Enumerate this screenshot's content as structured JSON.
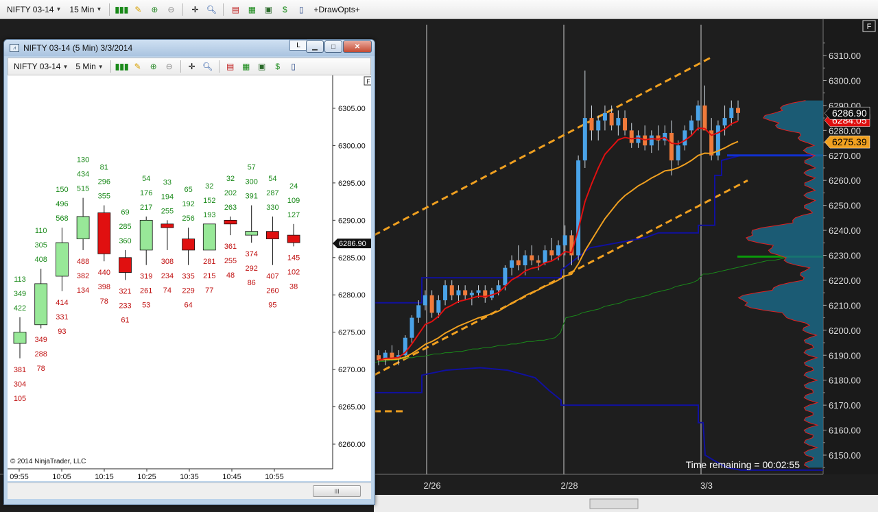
{
  "main_toolbar": {
    "instrument": "NIFTY 03-14",
    "interval": "15 Min",
    "draw_opts": "+DrawOpts+"
  },
  "float_window": {
    "title": "NIFTY 03-14 (5 Min)  3/3/2014",
    "l_button": "L",
    "instrument": "NIFTY 03-14",
    "interval": "5 Min",
    "scroll_thumb": "III"
  },
  "colors": {
    "bg_main": "#1e1e1e",
    "bull_candle": "#4aa3e8",
    "bear_candle": "#f07a3a",
    "ema_fast": "#e01010",
    "ema_slow": "#f0a020",
    "channel": "#f0a020",
    "vwap_band": "#1010a0",
    "green_line": "#1a8a1a",
    "profile_fill": "#1a6a8a",
    "profile_edge": "#e02020",
    "mini_bull": "#98e898",
    "mini_bear": "#e01010"
  },
  "chart_data": [
    {
      "type": "candlestick",
      "name": "main",
      "x_tick_labels": [
        "2/26",
        "2/28",
        "3/3"
      ],
      "y_tick_labels": [
        "6310.00",
        "6300.00",
        "6290.00",
        "6280.00",
        "6270.00",
        "6260.00",
        "6250.00",
        "6240.00",
        "6230.00",
        "6220.00",
        "6210.00",
        "6200.00",
        "6190.00",
        "6180.00",
        "6170.00",
        "6160.00",
        "6150.00"
      ],
      "ylim": [
        6142,
        6322
      ],
      "last_price_label": "6286.90",
      "hidden_price_label": "6284.05",
      "ema_price_label": "6275.39",
      "f_label": "F",
      "status_text": "Time remaining = 00:02:55",
      "ohlc": [
        [
          6190,
          6192,
          6186,
          6188
        ],
        [
          6188,
          6192,
          6186,
          6191
        ],
        [
          6191,
          6194,
          6188,
          6189
        ],
        [
          6189,
          6192,
          6186,
          6190
        ],
        [
          6190,
          6198,
          6189,
          6197
        ],
        [
          6197,
          6206,
          6195,
          6205
        ],
        [
          6205,
          6212,
          6203,
          6210
        ],
        [
          6210,
          6216,
          6208,
          6214
        ],
        [
          6214,
          6216,
          6205,
          6207
        ],
        [
          6207,
          6214,
          6205,
          6212
        ],
        [
          6212,
          6220,
          6210,
          6218
        ],
        [
          6218,
          6220,
          6212,
          6214
        ],
        [
          6214,
          6218,
          6211,
          6216
        ],
        [
          6216,
          6218,
          6212,
          6214
        ],
        [
          6214,
          6216,
          6210,
          6215
        ],
        [
          6215,
          6218,
          6213,
          6216
        ],
        [
          6216,
          6218,
          6211,
          6213
        ],
        [
          6213,
          6217,
          6212,
          6216
        ],
        [
          6216,
          6220,
          6214,
          6218
        ],
        [
          6218,
          6226,
          6216,
          6225
        ],
        [
          6225,
          6230,
          6222,
          6228
        ],
        [
          6228,
          6234,
          6224,
          6226
        ],
        [
          6226,
          6232,
          6222,
          6230
        ],
        [
          6230,
          6234,
          6226,
          6228
        ],
        [
          6228,
          6230,
          6224,
          6227
        ],
        [
          6227,
          6234,
          6226,
          6232
        ],
        [
          6232,
          6237,
          6228,
          6230
        ],
        [
          6230,
          6236,
          6228,
          6234
        ],
        [
          6234,
          6242,
          6230,
          6238
        ],
        [
          6238,
          6240,
          6226,
          6230
        ],
        [
          6230,
          6270,
          6228,
          6268
        ],
        [
          6268,
          6304,
          6265,
          6285
        ],
        [
          6285,
          6290,
          6276,
          6280
        ],
        [
          6280,
          6286,
          6276,
          6284
        ],
        [
          6284,
          6290,
          6280,
          6287
        ],
        [
          6287,
          6290,
          6280,
          6282
        ],
        [
          6282,
          6288,
          6278,
          6285
        ],
        [
          6285,
          6288,
          6278,
          6280
        ],
        [
          6280,
          6283,
          6273,
          6275
        ],
        [
          6275,
          6280,
          6273,
          6278
        ],
        [
          6278,
          6282,
          6272,
          6274
        ],
        [
          6274,
          6280,
          6271,
          6278
        ],
        [
          6278,
          6282,
          6272,
          6276
        ],
        [
          6276,
          6282,
          6274,
          6279
        ],
        [
          6279,
          6284,
          6262,
          6268
        ],
        [
          6268,
          6276,
          6266,
          6274
        ],
        [
          6274,
          6282,
          6272,
          6280
        ],
        [
          6280,
          6286,
          6278,
          6284
        ],
        [
          6284,
          6292,
          6280,
          6290
        ],
        [
          6290,
          6298,
          6286,
          6280
        ],
        [
          6280,
          6285,
          6268,
          6270
        ],
        [
          6270,
          6284,
          6268,
          6282
        ],
        [
          6282,
          6290,
          6278,
          6285
        ],
        [
          6285,
          6292,
          6282,
          6289
        ],
        [
          6289,
          6292,
          6284,
          6287
        ]
      ]
    },
    {
      "type": "candlestick",
      "name": "mini",
      "x_tick_labels": [
        "09:55",
        "10:05",
        "10:15",
        "10:25",
        "10:35",
        "10:45",
        "10:55"
      ],
      "y_tick_labels": [
        "6305.00",
        "6300.00",
        "6295.00",
        "6290.00",
        "6285.00",
        "6280.00",
        "6275.00",
        "6270.00",
        "6265.00",
        "6260.00"
      ],
      "ylim": [
        6257.5,
        6308.3
      ],
      "last_price_label": "6286.90",
      "f_label": "F",
      "copyright": "© 2014 NinjaTrader, LLC",
      "candles": [
        {
          "o": 6273.5,
          "h": 6277,
          "l": 6271.5,
          "c": 6275,
          "above": [
            "113",
            "349",
            "422"
          ],
          "below": [
            "381",
            "304",
            "105"
          ]
        },
        {
          "o": 6276,
          "h": 6283.5,
          "l": 6275.5,
          "c": 6281.5,
          "above": [
            "110",
            "305",
            "408"
          ],
          "below": [
            "349",
            "288",
            "78"
          ]
        },
        {
          "o": 6282.5,
          "h": 6289,
          "l": 6280.5,
          "c": 6287,
          "above": [
            "150",
            "496",
            "568"
          ],
          "below": [
            "414",
            "331",
            "93"
          ]
        },
        {
          "o": 6287.5,
          "h": 6293,
          "l": 6286,
          "c": 6290.5,
          "above": [
            "130",
            "434",
            "515"
          ],
          "below": [
            "488",
            "382",
            "134"
          ]
        },
        {
          "o": 6291,
          "h": 6292,
          "l": 6284.5,
          "c": 6285.5,
          "above": [
            "81",
            "296",
            "355"
          ],
          "below": [
            "440",
            "398",
            "78"
          ]
        },
        {
          "o": 6285,
          "h": 6286,
          "l": 6282,
          "c": 6283,
          "above": [
            "69",
            "285",
            "360"
          ],
          "below": [
            "321",
            "233",
            "61"
          ]
        },
        {
          "o": 6286,
          "h": 6290.5,
          "l": 6284,
          "c": 6290,
          "above": [
            "54",
            "176",
            "217"
          ],
          "below": [
            "319",
            "261",
            "53"
          ]
        },
        {
          "o": 6289.5,
          "h": 6290,
          "l": 6286,
          "c": 6289,
          "above": [
            "33",
            "194",
            "255"
          ],
          "below": [
            "308",
            "234",
            "74"
          ]
        },
        {
          "o": 6287.5,
          "h": 6289,
          "l": 6284,
          "c": 6286,
          "above": [
            "65",
            "192",
            "256"
          ],
          "below": [
            "335",
            "229",
            "64"
          ]
        },
        {
          "o": 6286,
          "h": 6289.5,
          "l": 6286,
          "c": 6289.5,
          "above": [
            "32",
            "152",
            "193"
          ],
          "below": [
            "281",
            "215",
            "77"
          ]
        },
        {
          "o": 6290,
          "h": 6290.5,
          "l": 6288,
          "c": 6289.5,
          "above": [
            "32",
            "202",
            "263"
          ],
          "below": [
            "361",
            "255",
            "48"
          ]
        },
        {
          "o": 6288,
          "h": 6292,
          "l": 6287,
          "c": 6288.5,
          "above": [
            "57",
            "300",
            "391"
          ],
          "below": [
            "374",
            "292",
            "86"
          ]
        },
        {
          "o": 6288.5,
          "h": 6290.5,
          "l": 6284,
          "c": 6287.5,
          "above": [
            "54",
            "287",
            "330"
          ],
          "below": [
            "407",
            "260",
            "95"
          ]
        },
        {
          "o": 6288,
          "h": 6289.5,
          "l": 6286.5,
          "c": 6287,
          "above": [
            "24",
            "109",
            "127"
          ],
          "below": [
            "145",
            "102",
            "38"
          ]
        }
      ]
    }
  ]
}
